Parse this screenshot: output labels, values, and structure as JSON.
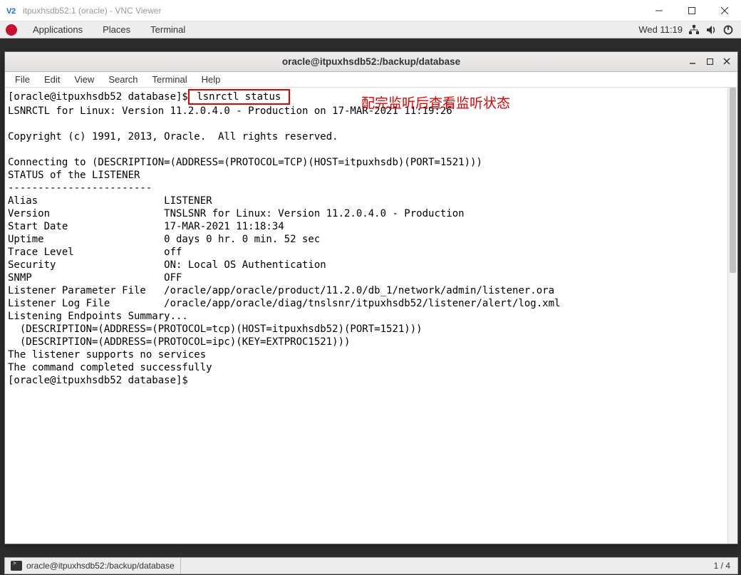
{
  "vnc": {
    "title": "itpuxhsdb52:1 (oracle) - VNC Viewer",
    "icon_text": "V2"
  },
  "panel": {
    "apps": [
      "Applications",
      "Places",
      "Terminal"
    ],
    "clock": "Wed 11:19"
  },
  "term_window": {
    "title": "oracle@itpuxhsdb52:/backup/database",
    "menu": [
      "File",
      "Edit",
      "View",
      "Search",
      "Terminal",
      "Help"
    ]
  },
  "terminal": {
    "prompt1": "[oracle@itpuxhsdb52 database]$",
    "command": " lsnrctl status ",
    "annotation": "配完监听后查看监听状态",
    "body": "\nLSNRCTL for Linux: Version 11.2.0.4.0 - Production on 17-MAR-2021 11:19:26\n\nCopyright (c) 1991, 2013, Oracle.  All rights reserved.\n\nConnecting to (DESCRIPTION=(ADDRESS=(PROTOCOL=TCP)(HOST=itpuxhsdb)(PORT=1521)))\nSTATUS of the LISTENER\n------------------------\nAlias                     LISTENER\nVersion                   TNSLSNR for Linux: Version 11.2.0.4.0 - Production\nStart Date                17-MAR-2021 11:18:34\nUptime                    0 days 0 hr. 0 min. 52 sec\nTrace Level               off\nSecurity                  ON: Local OS Authentication\nSNMP                      OFF\nListener Parameter File   /oracle/app/oracle/product/11.2.0/db_1/network/admin/listener.ora\nListener Log File         /oracle/app/oracle/diag/tnslsnr/itpuxhsdb52/listener/alert/log.xml\nListening Endpoints Summary...\n  (DESCRIPTION=(ADDRESS=(PROTOCOL=tcp)(HOST=itpuxhsdb52)(PORT=1521)))\n  (DESCRIPTION=(ADDRESS=(PROTOCOL=ipc)(KEY=EXTPROC1521)))\nThe listener supports no services\nThe command completed successfully\n[oracle@itpuxhsdb52 database]$"
  },
  "taskbar": {
    "item": "oracle@itpuxhsdb52:/backup/database",
    "pager": "1 / 4"
  }
}
